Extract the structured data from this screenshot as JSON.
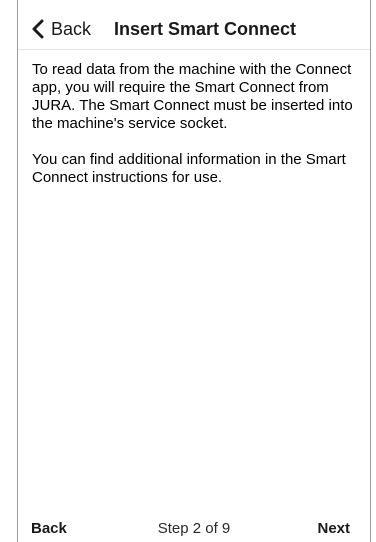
{
  "header": {
    "back_label": "Back",
    "title": "Insert Smart Connect"
  },
  "content": {
    "paragraph_1": "To read data from the machine with the Connect app, you will require the Smart Connect from JURA. The Smart Connect must be inserted into the machine's service socket.",
    "paragraph_2": "You can find additional information in the Smart Connect instructions for use."
  },
  "footer": {
    "back_label": "Back",
    "step_text": "Step 2 of 9",
    "next_label": "Next"
  },
  "icons": {
    "back": "chevron-left-icon"
  },
  "colors": {
    "background": "#ffffff",
    "text": "#1a1a1a",
    "divider": "#e4e4e4"
  }
}
